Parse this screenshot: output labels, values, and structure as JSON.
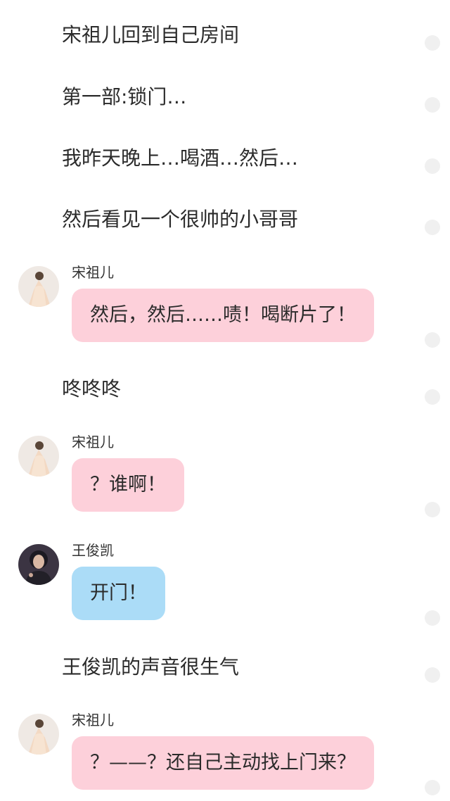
{
  "colors": {
    "background": "#ffffff",
    "bubble_pink": "#fdd0da",
    "bubble_blue": "#abdcf7",
    "dot": "#f0f0f0"
  },
  "narration": [
    "宋祖儿回到自己房间",
    "第一部:锁门…",
    "我昨天晚上…喝酒…然后…",
    "然后看见一个很帅的小哥哥",
    "咚咚咚",
    "王俊凯的声音很生气"
  ],
  "messages": [
    {
      "speaker": "宋祖儿",
      "avatar": "avatar-songzuer-icon",
      "text": "然后，然后……啧！喝断片了！",
      "color": "pink"
    },
    {
      "speaker": "宋祖儿",
      "avatar": "avatar-songzuer-icon",
      "text": "？谁啊！",
      "color": "pink"
    },
    {
      "speaker": "王俊凯",
      "avatar": "avatar-wangjunkai-icon",
      "text": "开门！",
      "color": "blue"
    },
    {
      "speaker": "宋祖儿",
      "avatar": "avatar-songzuer-icon",
      "text": "？——？还自己主动找上门来？",
      "color": "pink"
    }
  ],
  "row_marker_icon": "circle-dot-icon"
}
